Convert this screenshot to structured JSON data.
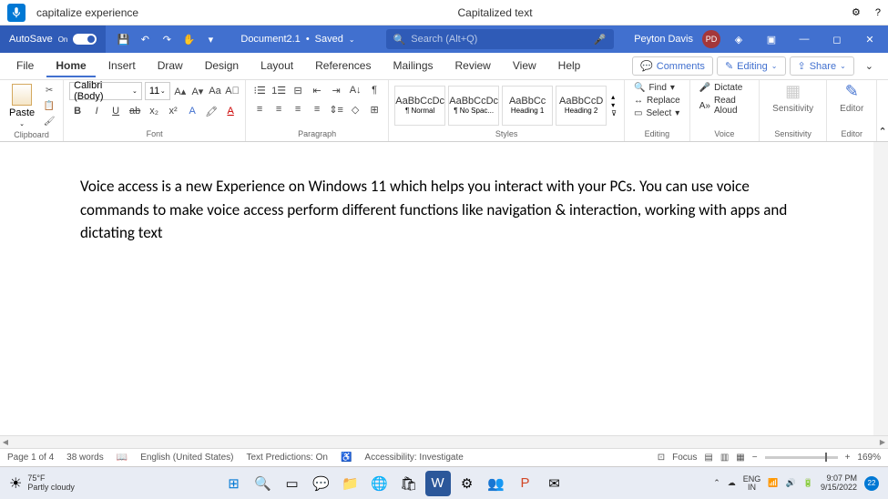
{
  "voice": {
    "command": "capitalize experience",
    "status": "Capitalized text"
  },
  "title": {
    "autosave": "AutoSave",
    "autosave_state": "On",
    "doc": "Document2.1",
    "saved": "Saved",
    "search_placeholder": "Search (Alt+Q)",
    "user": "Peyton Davis",
    "initials": "PD"
  },
  "tabs": [
    "File",
    "Home",
    "Insert",
    "Draw",
    "Design",
    "Layout",
    "References",
    "Mailings",
    "Review",
    "View",
    "Help"
  ],
  "active_tab": 1,
  "ribbon_right": {
    "comments": "Comments",
    "editing": "Editing",
    "share": "Share"
  },
  "groups": {
    "clipboard": {
      "label": "Clipboard",
      "paste": "Paste"
    },
    "font": {
      "label": "Font",
      "name": "Calibri (Body)",
      "size": "11"
    },
    "paragraph": {
      "label": "Paragraph"
    },
    "styles": {
      "label": "Styles",
      "items": [
        {
          "preview": "AaBbCcDc",
          "name": "¶ Normal"
        },
        {
          "preview": "AaBbCcDc",
          "name": "¶ No Spac..."
        },
        {
          "preview": "AaBbCc",
          "name": "Heading 1"
        },
        {
          "preview": "AaBbCcD",
          "name": "Heading 2"
        }
      ]
    },
    "editing": {
      "label": "Editing",
      "find": "Find",
      "replace": "Replace",
      "select": "Select"
    },
    "voice": {
      "label": "Voice",
      "dictate": "Dictate",
      "read": "Read Aloud"
    },
    "sensitivity": {
      "label": "Sensitivity",
      "btn": "Sensitivity"
    },
    "editor": {
      "label": "Editor",
      "btn": "Editor"
    }
  },
  "document": {
    "text": "Voice access is a new Experience on Windows 11 which helps you interact with your PCs. You can use voice commands to make voice access perform different functions like navigation & interaction, working with apps and dictating text"
  },
  "status": {
    "page": "Page 1 of 4",
    "words": "38 words",
    "lang": "English (United States)",
    "predictions": "Text Predictions: On",
    "accessibility": "Accessibility: Investigate",
    "focus": "Focus",
    "zoom": "169%"
  },
  "taskbar": {
    "temp": "75°F",
    "weather": "Partly cloudy",
    "lang": "ENG",
    "lang2": "IN",
    "time": "9:07 PM",
    "date": "9/15/2022",
    "notif": "22"
  }
}
